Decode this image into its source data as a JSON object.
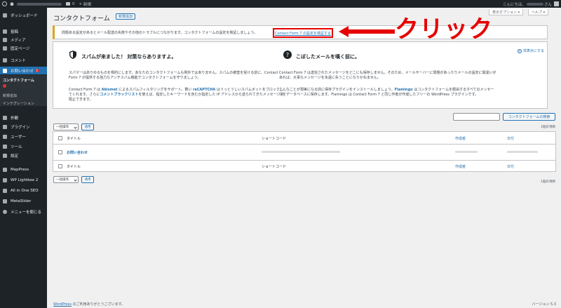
{
  "adminbar": {
    "new_label": "新規",
    "comments_count": "0",
    "greeting": "こんにちは、",
    "greeting_suffix": "さん"
  },
  "sidebar": {
    "items": [
      {
        "label": "ダッシュボード",
        "icon": "dashboard-icon"
      },
      {
        "label": "投稿",
        "icon": "pin-icon"
      },
      {
        "label": "メディア",
        "icon": "media-icon"
      },
      {
        "label": "固定ページ",
        "icon": "page-icon"
      },
      {
        "label": "コメント",
        "icon": "comment-icon"
      },
      {
        "label": "お問い合わせ",
        "icon": "mail-icon",
        "badge": "1"
      },
      {
        "label": "外観",
        "icon": "brush-icon"
      },
      {
        "label": "プラグイン",
        "icon": "plugin-icon"
      },
      {
        "label": "ユーザー",
        "icon": "user-icon"
      },
      {
        "label": "ツール",
        "icon": "tool-icon"
      },
      {
        "label": "設定",
        "icon": "settings-icon"
      },
      {
        "label": "MapPress",
        "icon": "map-pin-icon"
      },
      {
        "label": "WP Lightbox 2",
        "icon": "lightbox-icon"
      },
      {
        "label": "All in One SEO",
        "icon": "seo-icon"
      },
      {
        "label": "MetaSlider",
        "icon": "slider-icon"
      },
      {
        "label": "メニューを閉じる",
        "icon": "collapse-icon"
      }
    ],
    "submenu": [
      {
        "label": "コンタクトフォーム"
      },
      {
        "label": "新規追加"
      },
      {
        "label": "インテグレーション"
      }
    ]
  },
  "screen_options": "表示オプション ▾",
  "help": "ヘルプ ▾",
  "page": {
    "title": "コンタクトフォーム",
    "add_new": "新規追加"
  },
  "notice": {
    "text": "問題ある設定があるとメール配送の失敗やその他のトラブルにつながります。コンタクトフォームの設定を検証しましょう。",
    "link": "Contact Form 7 の設定を検証する"
  },
  "annotation": {
    "label": "クリック",
    "color": "#e60000"
  },
  "welcome": {
    "dismiss": "非表示にする",
    "left": {
      "title": "スパムが来ました！ 対策ならありますよ。",
      "p1": "スパマーはありゆるものを標的にします。あなたのコンタクトフォームも例外ではありません。スパムの被害を受ける前に、Contact Form 7 が提供する強力なアンチスパム機能でコンタクトフォームを守りましょう。",
      "p2_a": "Contact Form 7 は ",
      "p2_akismet": "Akismet",
      "p2_b": " によるスパムフィルタリングをサポート。賢い ",
      "p2_recaptcha": "reCAPTCHA",
      "p2_c": " はうっとうしいスパムボットをブロックしてくれます。さらに",
      "p2_blocklist": "コメントブラックリスト",
      "p2_d": "を使えば、指定したキーワードを含むか指定した IP アドレスから送られてきたメッセージを阻止できます。"
    },
    "right": {
      "title": "こぼしたメールを嘆く前に。",
      "p1": "Contact Form 7 は送信されたメッセージをどこにも保存しません。そのため、メールサーバーに問題があったりメールの設定に間違いがあれば、大事なメッセージを永遠に失うことになりかねません。",
      "p2_a": "こんなことが現実になる前に保存プラグインをインストールしましょう。",
      "p2_flamingo": "Flamingo",
      "p2_b": " はコンタクトフォームを経由するすべてのメッセージをデータベースに保存します。Flamingo は Contact Form 7 と同じ作者が作成したフリーの WordPress プラグインです。"
    }
  },
  "search": {
    "button": "コンタクトフォームの検索"
  },
  "bulk": {
    "label": "一括操作",
    "apply": "適用"
  },
  "count": "1個の項目",
  "table": {
    "headers": {
      "title": "タイトル",
      "shortcode": "ショートコード",
      "author": "作成者",
      "date": "日付"
    },
    "rows": [
      {
        "title": "お問い合わせ"
      }
    ]
  },
  "footer": {
    "left_link": "WordPress",
    "left_text": " のご利用ありがとうございます。",
    "version": "バージョン 5.3"
  }
}
